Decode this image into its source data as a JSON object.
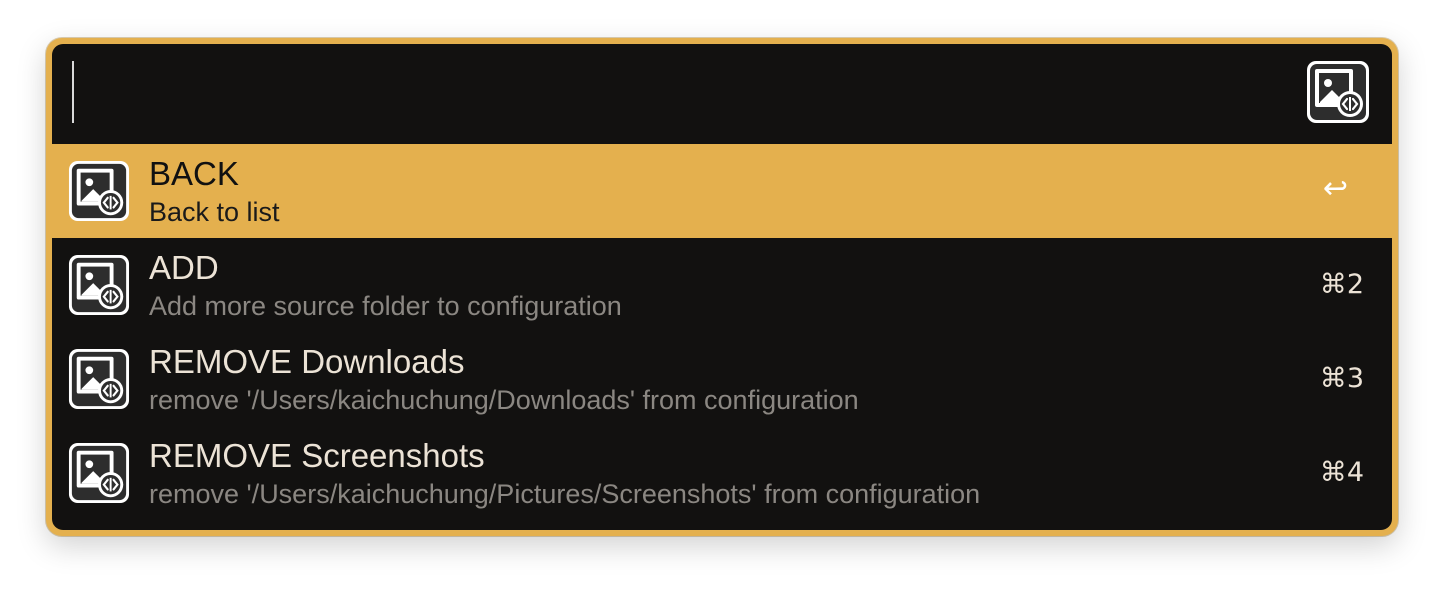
{
  "search": {
    "value": "",
    "placeholder": ""
  },
  "header": {
    "icon": "image-compare-icon"
  },
  "results": [
    {
      "title": "BACK",
      "subtitle": "Back to list",
      "shortcut": "↩",
      "icon": "image-compare-icon",
      "selected": true
    },
    {
      "title": "ADD",
      "subtitle": "Add more source folder to configuration",
      "shortcut": "⌘2",
      "icon": "image-compare-icon",
      "selected": false
    },
    {
      "title": "REMOVE Downloads",
      "subtitle": "remove '/Users/kaichuchung/Downloads' from configuration",
      "shortcut": "⌘3",
      "icon": "image-compare-icon",
      "selected": false
    },
    {
      "title": "REMOVE Screenshots",
      "subtitle": "remove '/Users/kaichuchung/Pictures/Screenshots' from configuration",
      "shortcut": "⌘4",
      "icon": "image-compare-icon",
      "selected": false
    }
  ],
  "colors": {
    "accent": "#e4b04e",
    "background": "#121110",
    "title_text": "#ece3d6",
    "subtitle_text": "#8b8782"
  }
}
